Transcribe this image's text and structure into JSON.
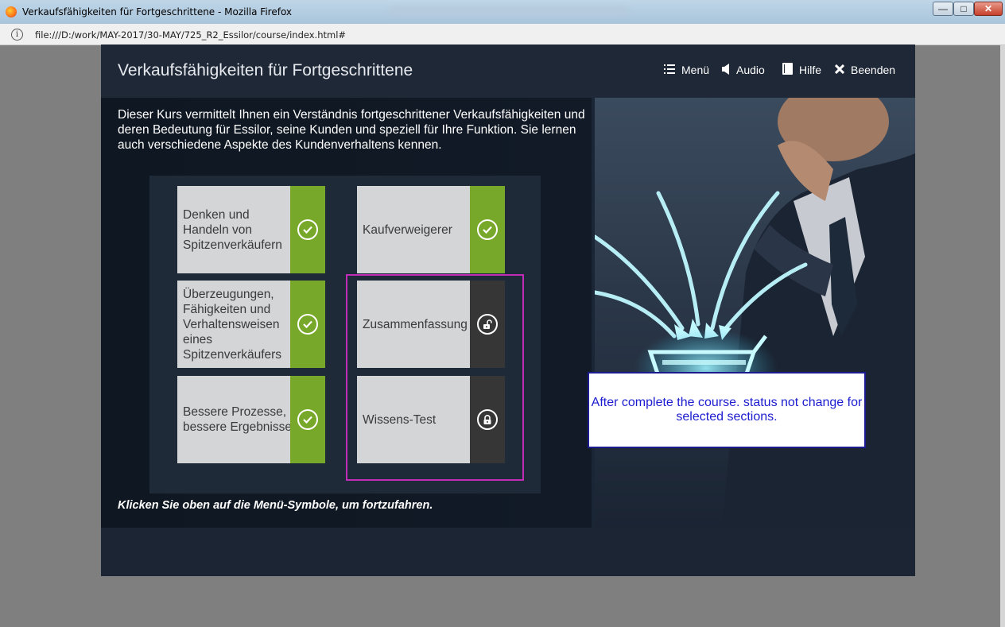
{
  "window": {
    "title": "Verkaufsfähigkeiten für Fortgeschrittene - Mozilla Firefox",
    "url": "file:///D:/work/MAY-2017/30-MAY/725_R2_Essilor/course/index.html#",
    "controls": {
      "minimize": "—",
      "maximize": "□",
      "close": "✕"
    }
  },
  "course": {
    "title": "Verkaufsfähigkeiten für Fortgeschrittene",
    "nav": [
      {
        "label": "Menü",
        "icon": "menu-list-icon"
      },
      {
        "label": "Audio",
        "icon": "speaker-icon"
      },
      {
        "label": "Hilfe",
        "icon": "help-book-icon"
      },
      {
        "label": "Beenden",
        "icon": "close-x-icon"
      }
    ],
    "intro": "Dieser Kurs vermittelt Ihnen ein Verständnis fortgeschrittener Verkaufsfähigkeiten und deren Bedeutung für Essilor, seine Kunden und speziell für Ihre Funktion. Sie lernen auch verschiedene Aspekte des Kundenverhaltens kennen.",
    "modules": [
      {
        "label": "Denken und Handeln von Spitzenverkäufern",
        "status": "completed",
        "icon": "check-circle-icon"
      },
      {
        "label": "Kaufverweigerer",
        "status": "completed",
        "icon": "check-circle-icon"
      },
      {
        "label": "Überzeugungen, Fähigkeiten und Verhaltensweisen eines Spitzenverkäufers",
        "status": "completed",
        "icon": "check-circle-icon"
      },
      {
        "label": "Zusammenfassung",
        "status": "unlocked",
        "icon": "unlocked-padlock-icon"
      },
      {
        "label": "Bessere Prozesse, bessere Ergebnisse",
        "status": "completed",
        "icon": "check-circle-icon"
      },
      {
        "label": "Wissens-Test",
        "status": "locked",
        "icon": "locked-padlock-icon"
      }
    ],
    "footer_note": "Klicken Sie oben auf die Menü-Symbole, um fortzufahren."
  },
  "annotation": {
    "text": "After complete the course. status not change for selected sections."
  },
  "colors": {
    "completed": "#78a82a",
    "locked": "#363636",
    "highlight": "#c02bb8",
    "annotation_text": "#1c1cd0"
  }
}
